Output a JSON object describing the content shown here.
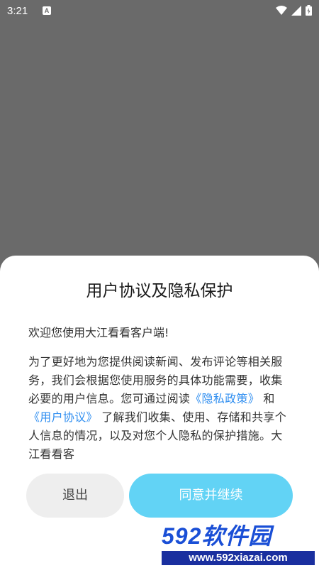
{
  "status_bar": {
    "time": "3:21",
    "indicator": "A",
    "icons": [
      "wifi-icon",
      "signal-icon",
      "battery-icon"
    ]
  },
  "dialog": {
    "title": "用户协议及隐私保护",
    "greeting": "欢迎您使用大江看看客户端!",
    "body_before_links": "为了更好地为您提供阅读新闻、发布评论等相关服务，我们会根据您使用服务的具体功能需要，收集必要的用户信息。您可通过阅读",
    "privacy_link": "《隐私政策》",
    "conjunction": " 和 ",
    "agreement_link": "《用户协议》",
    "body_after_links": " 了解我们收集、使用、存储和共享个人信息的情况，以及对您个人隐私的保护措施。大江看看客",
    "exit_button": "退出",
    "agree_button": "同意并继续"
  },
  "watermark": {
    "logo_text": "592软件园",
    "url": "www.592xiazai.com"
  },
  "colors": {
    "backdrop": "#6a6a6a",
    "link": "#2f8ef0",
    "agree_button": "#62d3f5",
    "exit_button": "#eeeeee"
  }
}
